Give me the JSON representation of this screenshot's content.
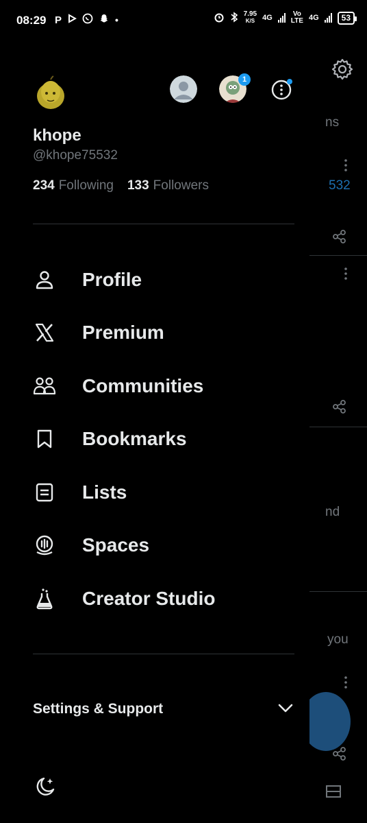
{
  "status_bar": {
    "time": "08:29",
    "left_icons": [
      "P",
      "▷",
      "whatsapp-icon",
      "snapchat-icon",
      "•"
    ],
    "speed_value": "7.95",
    "speed_unit": "K/S",
    "net1": "4G",
    "net2_top": "Vo",
    "net2_bottom": "LTE",
    "net3": "4G",
    "battery": "53"
  },
  "drawer": {
    "account_badge_count": "1",
    "display_name": "khope",
    "handle": "@khope75532",
    "following_count": "234",
    "following_label": "Following",
    "followers_count": "133",
    "followers_label": "Followers",
    "menu": [
      {
        "label": "Profile",
        "icon": "person-icon"
      },
      {
        "label": "Premium",
        "icon": "x-logo-icon"
      },
      {
        "label": "Communities",
        "icon": "communities-icon"
      },
      {
        "label": "Bookmarks",
        "icon": "bookmark-icon"
      },
      {
        "label": "Lists",
        "icon": "list-icon"
      },
      {
        "label": "Spaces",
        "icon": "spaces-icon"
      },
      {
        "label": "Creator Studio",
        "icon": "flask-icon"
      }
    ],
    "settings_label": "Settings & Support"
  },
  "background_feed": {
    "snippet1": "ns",
    "snippet2": "532",
    "snippet3": "nd",
    "snippet4": "you"
  },
  "colors": {
    "background": "#000000",
    "text_primary": "#e7e9ea",
    "text_secondary": "#71767b",
    "accent": "#1d9bf0",
    "divider": "#2f3336"
  }
}
